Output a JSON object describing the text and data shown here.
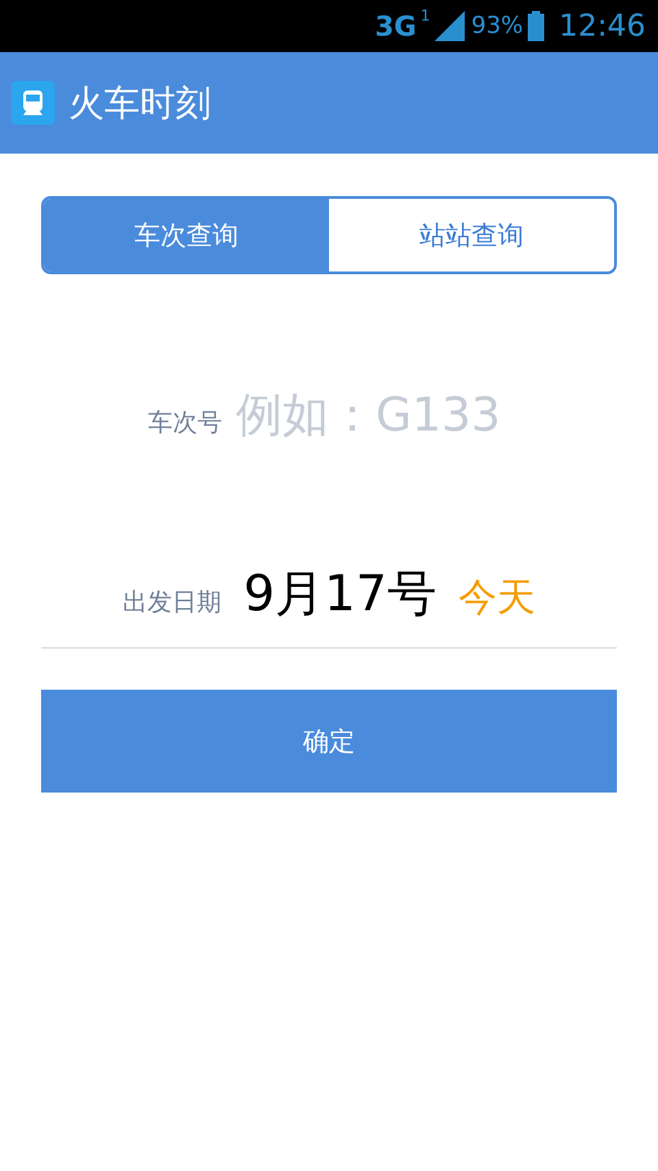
{
  "status_bar": {
    "network": "3G",
    "sim": "1",
    "battery": "93%",
    "time": "12:46"
  },
  "app_bar": {
    "title": "火车时刻"
  },
  "tabs": [
    {
      "label": "车次查询",
      "selected": true
    },
    {
      "label": "站站查询",
      "selected": false
    }
  ],
  "train_field": {
    "label": "车次号",
    "placeholder": "例如：G133"
  },
  "date_field": {
    "label": "出发日期",
    "value": "9月17号",
    "note": "今天"
  },
  "confirm_button": "确定"
}
